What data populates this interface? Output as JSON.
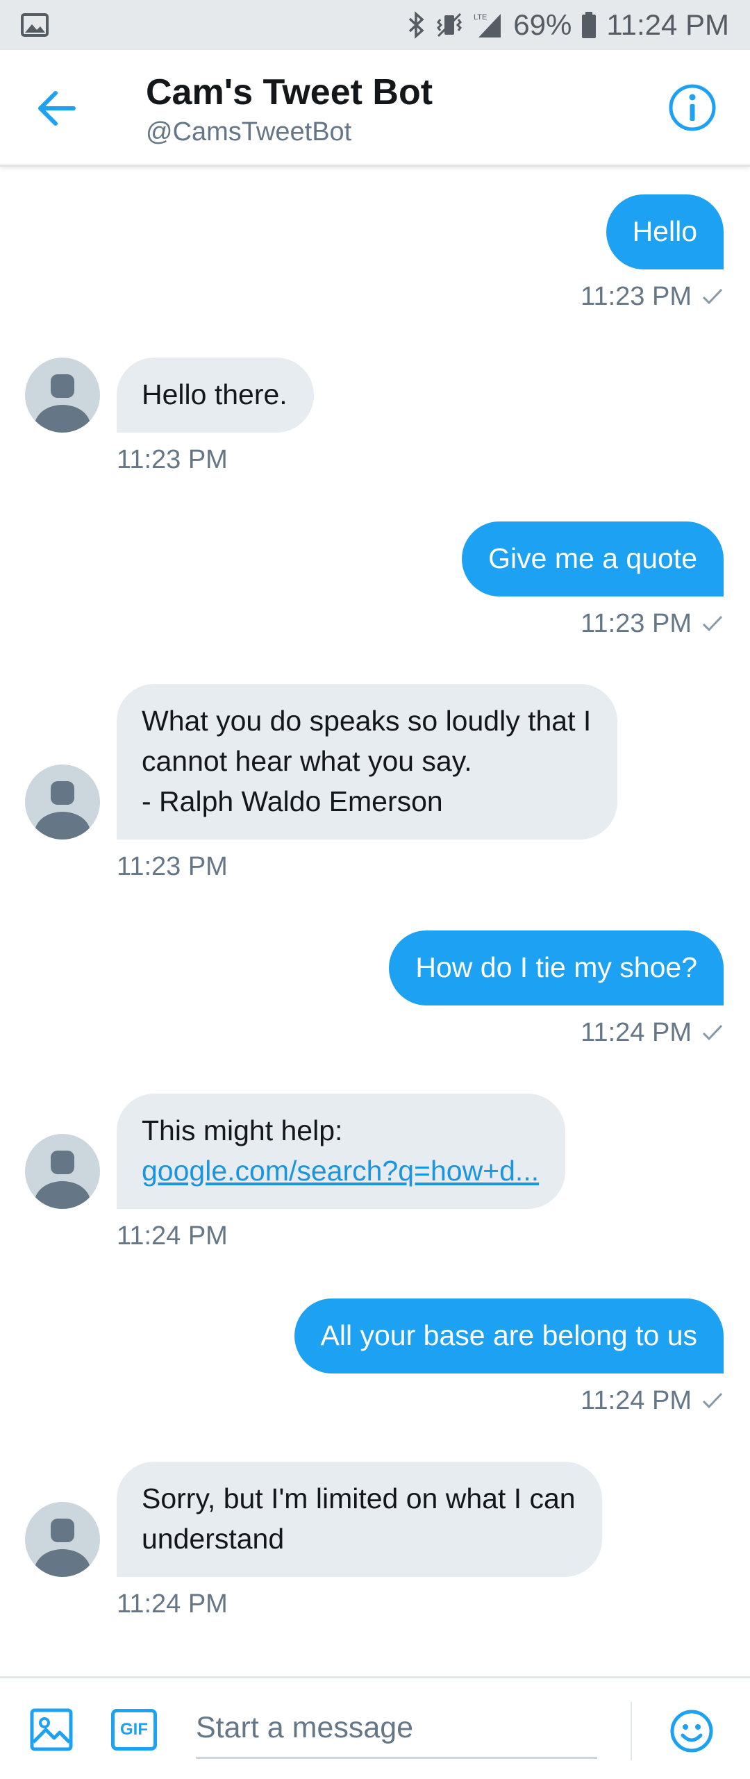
{
  "status_bar": {
    "battery": "69%",
    "time": "11:24 PM",
    "icons": [
      "image-notification-icon",
      "bluetooth-icon",
      "vibrate-icon",
      "lte-signal-icon",
      "battery-icon"
    ]
  },
  "header": {
    "title": "Cam's Tweet Bot",
    "handle": "@CamsTweetBot",
    "icons": [
      "back-arrow-icon",
      "info-icon"
    ]
  },
  "messages": [
    {
      "direction": "out",
      "text": "Hello",
      "time": "11:23 PM"
    },
    {
      "direction": "in",
      "text": "Hello there.",
      "time": "11:23 PM"
    },
    {
      "direction": "out",
      "text": "Give me a quote",
      "time": "11:23 PM"
    },
    {
      "direction": "in",
      "lines": [
        "What you do speaks so loudly that I",
        "cannot hear what you say.",
        "- Ralph Waldo Emerson"
      ],
      "time": "11:23 PM"
    },
    {
      "direction": "out",
      "text": "How do I tie my shoe?",
      "time": "11:24 PM"
    },
    {
      "direction": "in",
      "text": "This might help:",
      "link": "google.com/search?q=how+d...",
      "time": "11:24 PM"
    },
    {
      "direction": "out",
      "text": "All your base are belong to us",
      "time": "11:24 PM"
    },
    {
      "direction": "in",
      "lines": [
        "Sorry, but I'm limited on what I can",
        "understand"
      ],
      "time": "11:24 PM"
    }
  ],
  "composer": {
    "placeholder": "Start a message",
    "gif_label": "GIF",
    "icons": [
      "image-icon",
      "gif-icon",
      "emoji-icon"
    ]
  },
  "colors": {
    "accent": "#1da1f2",
    "incoming_bubble": "#e6ecf0",
    "secondary_text": "#657786"
  }
}
